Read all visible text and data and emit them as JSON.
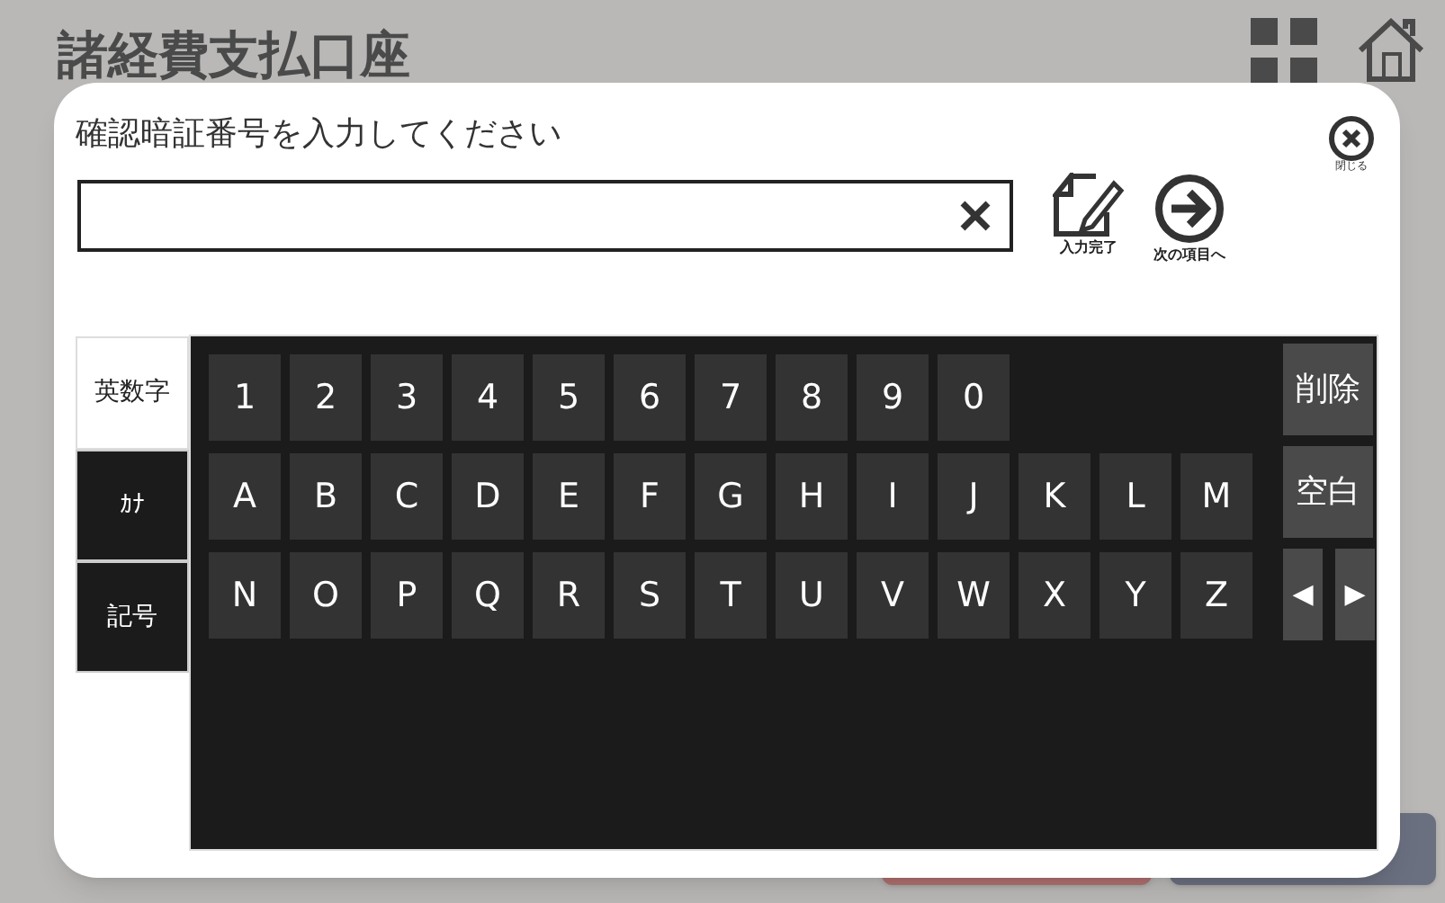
{
  "page": {
    "title": "諸経費支払口座"
  },
  "dialog": {
    "prompt": "確認暗証番号を入力してください",
    "close_label": "閉じる",
    "actions": [
      {
        "kind": "done",
        "label": "入力完了"
      },
      {
        "kind": "next",
        "label": "次の項目へ"
      }
    ],
    "tabs": [
      {
        "label": "英数字",
        "selected": true
      },
      {
        "label": "ｶﾅ",
        "selected": false
      },
      {
        "label": "記号",
        "selected": false
      }
    ],
    "key_rows": [
      [
        "1",
        "2",
        "3",
        "4",
        "5",
        "6",
        "7",
        "8",
        "9",
        "0"
      ],
      [
        "A",
        "B",
        "C",
        "D",
        "E",
        "F",
        "G",
        "H",
        "I",
        "J",
        "K",
        "L",
        "M"
      ],
      [
        "N",
        "O",
        "P",
        "Q",
        "R",
        "S",
        "T",
        "U",
        "V",
        "W",
        "X",
        "Y",
        "Z"
      ]
    ],
    "side_keys": [
      "削除",
      "空白"
    ],
    "arrow_keys": [
      "◀",
      "▶"
    ]
  }
}
